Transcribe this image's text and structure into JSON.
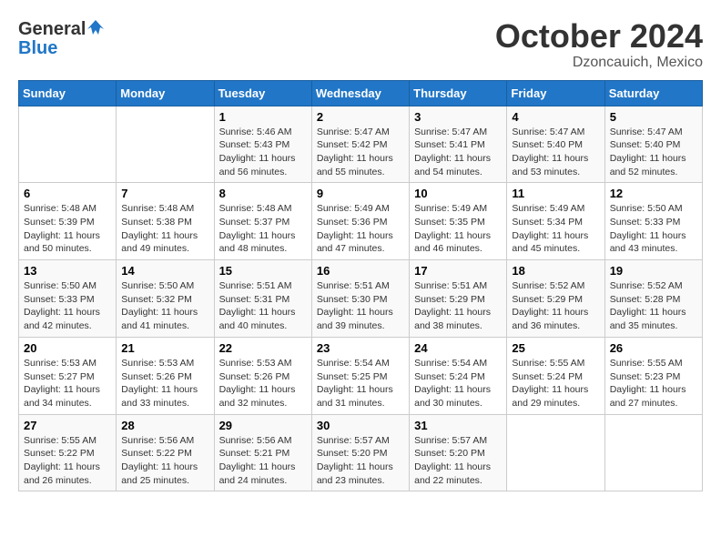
{
  "header": {
    "logo_general": "General",
    "logo_blue": "Blue",
    "month": "October 2024",
    "location": "Dzoncauich, Mexico"
  },
  "weekdays": [
    "Sunday",
    "Monday",
    "Tuesday",
    "Wednesday",
    "Thursday",
    "Friday",
    "Saturday"
  ],
  "weeks": [
    [
      {
        "day": "",
        "info": ""
      },
      {
        "day": "",
        "info": ""
      },
      {
        "day": "1",
        "info": "Sunrise: 5:46 AM\nSunset: 5:43 PM\nDaylight: 11 hours and 56 minutes."
      },
      {
        "day": "2",
        "info": "Sunrise: 5:47 AM\nSunset: 5:42 PM\nDaylight: 11 hours and 55 minutes."
      },
      {
        "day": "3",
        "info": "Sunrise: 5:47 AM\nSunset: 5:41 PM\nDaylight: 11 hours and 54 minutes."
      },
      {
        "day": "4",
        "info": "Sunrise: 5:47 AM\nSunset: 5:40 PM\nDaylight: 11 hours and 53 minutes."
      },
      {
        "day": "5",
        "info": "Sunrise: 5:47 AM\nSunset: 5:40 PM\nDaylight: 11 hours and 52 minutes."
      }
    ],
    [
      {
        "day": "6",
        "info": "Sunrise: 5:48 AM\nSunset: 5:39 PM\nDaylight: 11 hours and 50 minutes."
      },
      {
        "day": "7",
        "info": "Sunrise: 5:48 AM\nSunset: 5:38 PM\nDaylight: 11 hours and 49 minutes."
      },
      {
        "day": "8",
        "info": "Sunrise: 5:48 AM\nSunset: 5:37 PM\nDaylight: 11 hours and 48 minutes."
      },
      {
        "day": "9",
        "info": "Sunrise: 5:49 AM\nSunset: 5:36 PM\nDaylight: 11 hours and 47 minutes."
      },
      {
        "day": "10",
        "info": "Sunrise: 5:49 AM\nSunset: 5:35 PM\nDaylight: 11 hours and 46 minutes."
      },
      {
        "day": "11",
        "info": "Sunrise: 5:49 AM\nSunset: 5:34 PM\nDaylight: 11 hours and 45 minutes."
      },
      {
        "day": "12",
        "info": "Sunrise: 5:50 AM\nSunset: 5:33 PM\nDaylight: 11 hours and 43 minutes."
      }
    ],
    [
      {
        "day": "13",
        "info": "Sunrise: 5:50 AM\nSunset: 5:33 PM\nDaylight: 11 hours and 42 minutes."
      },
      {
        "day": "14",
        "info": "Sunrise: 5:50 AM\nSunset: 5:32 PM\nDaylight: 11 hours and 41 minutes."
      },
      {
        "day": "15",
        "info": "Sunrise: 5:51 AM\nSunset: 5:31 PM\nDaylight: 11 hours and 40 minutes."
      },
      {
        "day": "16",
        "info": "Sunrise: 5:51 AM\nSunset: 5:30 PM\nDaylight: 11 hours and 39 minutes."
      },
      {
        "day": "17",
        "info": "Sunrise: 5:51 AM\nSunset: 5:29 PM\nDaylight: 11 hours and 38 minutes."
      },
      {
        "day": "18",
        "info": "Sunrise: 5:52 AM\nSunset: 5:29 PM\nDaylight: 11 hours and 36 minutes."
      },
      {
        "day": "19",
        "info": "Sunrise: 5:52 AM\nSunset: 5:28 PM\nDaylight: 11 hours and 35 minutes."
      }
    ],
    [
      {
        "day": "20",
        "info": "Sunrise: 5:53 AM\nSunset: 5:27 PM\nDaylight: 11 hours and 34 minutes."
      },
      {
        "day": "21",
        "info": "Sunrise: 5:53 AM\nSunset: 5:26 PM\nDaylight: 11 hours and 33 minutes."
      },
      {
        "day": "22",
        "info": "Sunrise: 5:53 AM\nSunset: 5:26 PM\nDaylight: 11 hours and 32 minutes."
      },
      {
        "day": "23",
        "info": "Sunrise: 5:54 AM\nSunset: 5:25 PM\nDaylight: 11 hours and 31 minutes."
      },
      {
        "day": "24",
        "info": "Sunrise: 5:54 AM\nSunset: 5:24 PM\nDaylight: 11 hours and 30 minutes."
      },
      {
        "day": "25",
        "info": "Sunrise: 5:55 AM\nSunset: 5:24 PM\nDaylight: 11 hours and 29 minutes."
      },
      {
        "day": "26",
        "info": "Sunrise: 5:55 AM\nSunset: 5:23 PM\nDaylight: 11 hours and 27 minutes."
      }
    ],
    [
      {
        "day": "27",
        "info": "Sunrise: 5:55 AM\nSunset: 5:22 PM\nDaylight: 11 hours and 26 minutes."
      },
      {
        "day": "28",
        "info": "Sunrise: 5:56 AM\nSunset: 5:22 PM\nDaylight: 11 hours and 25 minutes."
      },
      {
        "day": "29",
        "info": "Sunrise: 5:56 AM\nSunset: 5:21 PM\nDaylight: 11 hours and 24 minutes."
      },
      {
        "day": "30",
        "info": "Sunrise: 5:57 AM\nSunset: 5:20 PM\nDaylight: 11 hours and 23 minutes."
      },
      {
        "day": "31",
        "info": "Sunrise: 5:57 AM\nSunset: 5:20 PM\nDaylight: 11 hours and 22 minutes."
      },
      {
        "day": "",
        "info": ""
      },
      {
        "day": "",
        "info": ""
      }
    ]
  ]
}
